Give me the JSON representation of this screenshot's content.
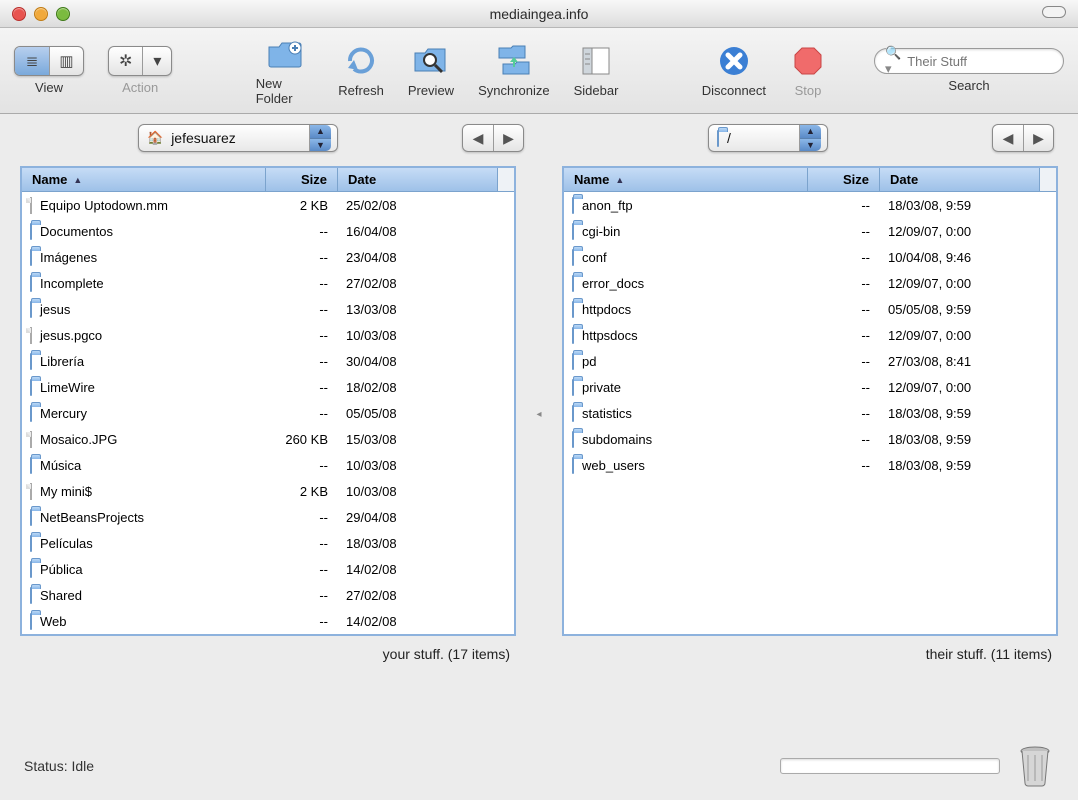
{
  "window": {
    "title": "mediaingea.info"
  },
  "toolbar": {
    "view_label": "View",
    "action_label": "Action",
    "newfolder_label": "New Folder",
    "refresh_label": "Refresh",
    "preview_label": "Preview",
    "synchronize_label": "Synchronize",
    "sidebar_label": "Sidebar",
    "disconnect_label": "Disconnect",
    "stop_label": "Stop",
    "search_label": "Search",
    "search_placeholder": "Their Stuff"
  },
  "local": {
    "path": "jefesuarez",
    "cols": {
      "name": "Name",
      "size": "Size",
      "date": "Date"
    },
    "summary": "your stuff. (17 items)",
    "items": [
      {
        "icon": "file",
        "name": "Equipo Uptodown.mm",
        "size": "2 KB",
        "date": "25/02/08"
      },
      {
        "icon": "folder",
        "name": "Documentos",
        "size": "--",
        "date": "16/04/08"
      },
      {
        "icon": "folder",
        "name": "Imágenes",
        "size": "--",
        "date": "23/04/08"
      },
      {
        "icon": "folder",
        "name": "Incomplete",
        "size": "--",
        "date": "27/02/08"
      },
      {
        "icon": "folder",
        "name": "jesus",
        "size": "--",
        "date": "13/03/08"
      },
      {
        "icon": "file",
        "name": "jesus.pgco",
        "size": "--",
        "date": "10/03/08"
      },
      {
        "icon": "folder",
        "name": "Librería",
        "size": "--",
        "date": "30/04/08"
      },
      {
        "icon": "folder",
        "name": "LimeWire",
        "size": "--",
        "date": "18/02/08"
      },
      {
        "icon": "folder",
        "name": "Mercury",
        "size": "--",
        "date": "05/05/08"
      },
      {
        "icon": "file",
        "name": "Mosaico.JPG",
        "size": "260 KB",
        "date": "15/03/08"
      },
      {
        "icon": "folder",
        "name": "Música",
        "size": "--",
        "date": "10/03/08"
      },
      {
        "icon": "file",
        "name": "My mini$",
        "size": "2 KB",
        "date": "10/03/08"
      },
      {
        "icon": "folder",
        "name": "NetBeansProjects",
        "size": "--",
        "date": "29/04/08"
      },
      {
        "icon": "folder",
        "name": "Películas",
        "size": "--",
        "date": "18/03/08"
      },
      {
        "icon": "folder",
        "name": "Pública",
        "size": "--",
        "date": "14/02/08"
      },
      {
        "icon": "folder",
        "name": "Shared",
        "size": "--",
        "date": "27/02/08"
      },
      {
        "icon": "folder",
        "name": "Web",
        "size": "--",
        "date": "14/02/08"
      }
    ]
  },
  "remote": {
    "path": "/",
    "cols": {
      "name": "Name",
      "size": "Size",
      "date": "Date"
    },
    "summary": "their stuff. (11 items)",
    "items": [
      {
        "icon": "folder",
        "name": "anon_ftp",
        "size": "--",
        "date": "18/03/08, 9:59"
      },
      {
        "icon": "folder",
        "name": "cgi-bin",
        "size": "--",
        "date": "12/09/07, 0:00"
      },
      {
        "icon": "folder",
        "name": "conf",
        "size": "--",
        "date": "10/04/08, 9:46"
      },
      {
        "icon": "folder",
        "name": "error_docs",
        "size": "--",
        "date": "12/09/07, 0:00"
      },
      {
        "icon": "folder",
        "name": "httpdocs",
        "size": "--",
        "date": "05/05/08, 9:59"
      },
      {
        "icon": "folder",
        "name": "httpsdocs",
        "size": "--",
        "date": "12/09/07, 0:00"
      },
      {
        "icon": "folder",
        "name": "pd",
        "size": "--",
        "date": "27/03/08, 8:41"
      },
      {
        "icon": "folder",
        "name": "private",
        "size": "--",
        "date": "12/09/07, 0:00"
      },
      {
        "icon": "folder",
        "name": "statistics",
        "size": "--",
        "date": "18/03/08, 9:59"
      },
      {
        "icon": "folder",
        "name": "subdomains",
        "size": "--",
        "date": "18/03/08, 9:59"
      },
      {
        "icon": "folder",
        "name": "web_users",
        "size": "--",
        "date": "18/03/08, 9:59"
      }
    ]
  },
  "status": {
    "text": "Status: Idle"
  }
}
